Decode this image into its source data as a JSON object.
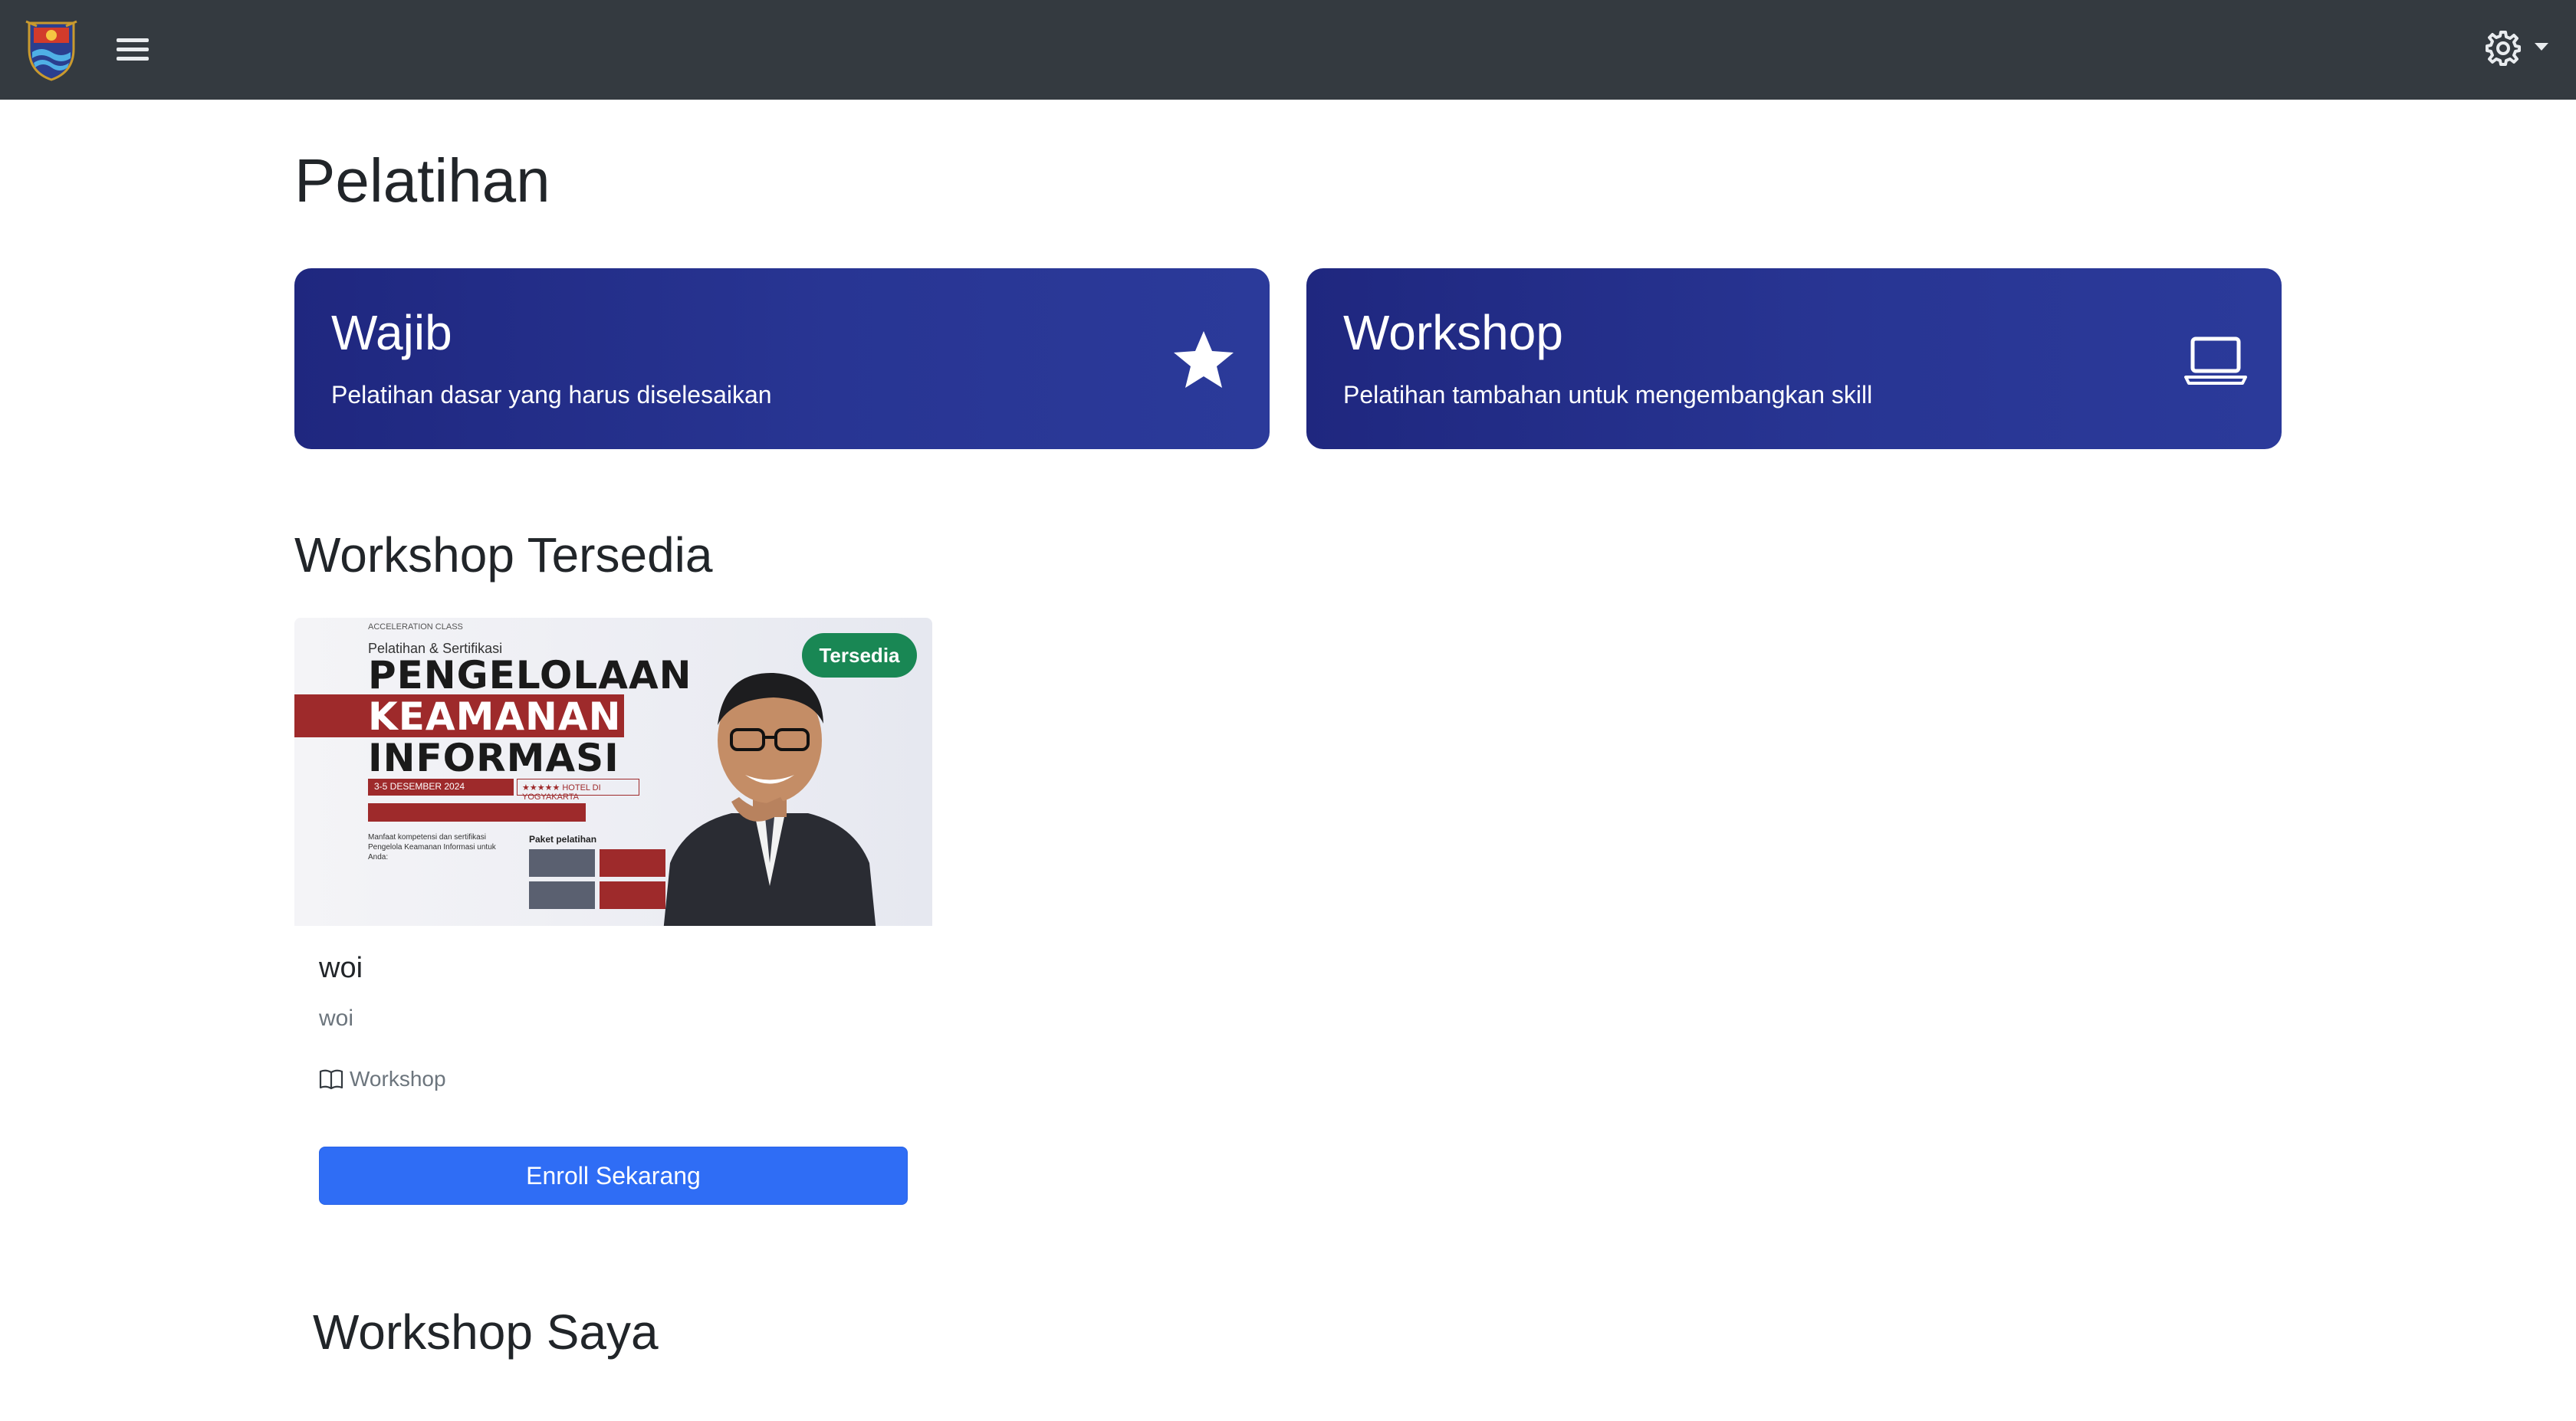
{
  "navbar": {
    "logo_icon": "city-crest-logo",
    "menu_icon": "hamburger-icon",
    "settings_icon": "gear-icon"
  },
  "page": {
    "title": "Pelatihan"
  },
  "categories": [
    {
      "title": "Wajib",
      "description": "Pelatihan dasar yang harus diselesaikan",
      "icon": "star-icon"
    },
    {
      "title": "Workshop",
      "description": "Pelatihan tambahan untuk mengembangkan skill",
      "icon": "laptop-icon"
    }
  ],
  "sections": {
    "available_title": "Workshop Tersedia",
    "mine_title": "Workshop Saya"
  },
  "workshops": [
    {
      "badge": "Tersedia",
      "title": "woi",
      "description": "woi",
      "category_label": "Workshop",
      "category_icon": "book-icon",
      "button_label": "Enroll Sekarang",
      "poster": {
        "header_small": "ACCELERATION CLASS",
        "subtitle": "Pelatihan & Sertifikasi",
        "line1": "PENGELOLAAN",
        "line2": "KEAMANAN",
        "line3": "INFORMASI",
        "date": "3-5 DESEMBER 2024",
        "venue": "★★★★★ HOTEL DI YOGYAKARTA",
        "benefit_title": "Manfaat kompetensi dan sertifikasi Pengelola Keamanan Informasi untuk Anda:",
        "package_title": "Paket pelatihan"
      }
    }
  ],
  "colors": {
    "navbar": "#343a40",
    "card_gradient_start": "#1f277f",
    "card_gradient_end": "#2b3a9a",
    "badge_success": "#198754",
    "primary_button": "#2f6df5"
  }
}
